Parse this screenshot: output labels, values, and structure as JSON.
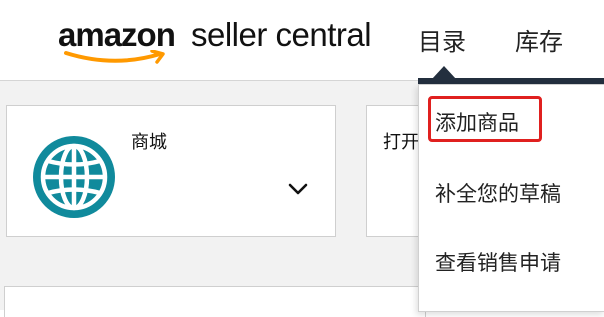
{
  "header": {
    "logo_brand": "amazon",
    "logo_product": "seller central",
    "nav": {
      "catalog": "目录",
      "inventory": "库存"
    }
  },
  "cards": {
    "store": {
      "label": "商城",
      "icon": "globe-icon",
      "expand_icon": "chevron-down-icon"
    },
    "open": {
      "label": "打开"
    }
  },
  "dropdown": {
    "items": [
      {
        "label": "添加商品",
        "highlighted": true
      },
      {
        "label": "补全您的草稿"
      },
      {
        "label": "查看销售申请"
      }
    ]
  },
  "colors": {
    "accent_dark": "#232f3e",
    "smile_orange": "#ff9900",
    "globe_teal": "#108a9c",
    "highlight_red": "#e0201f"
  }
}
